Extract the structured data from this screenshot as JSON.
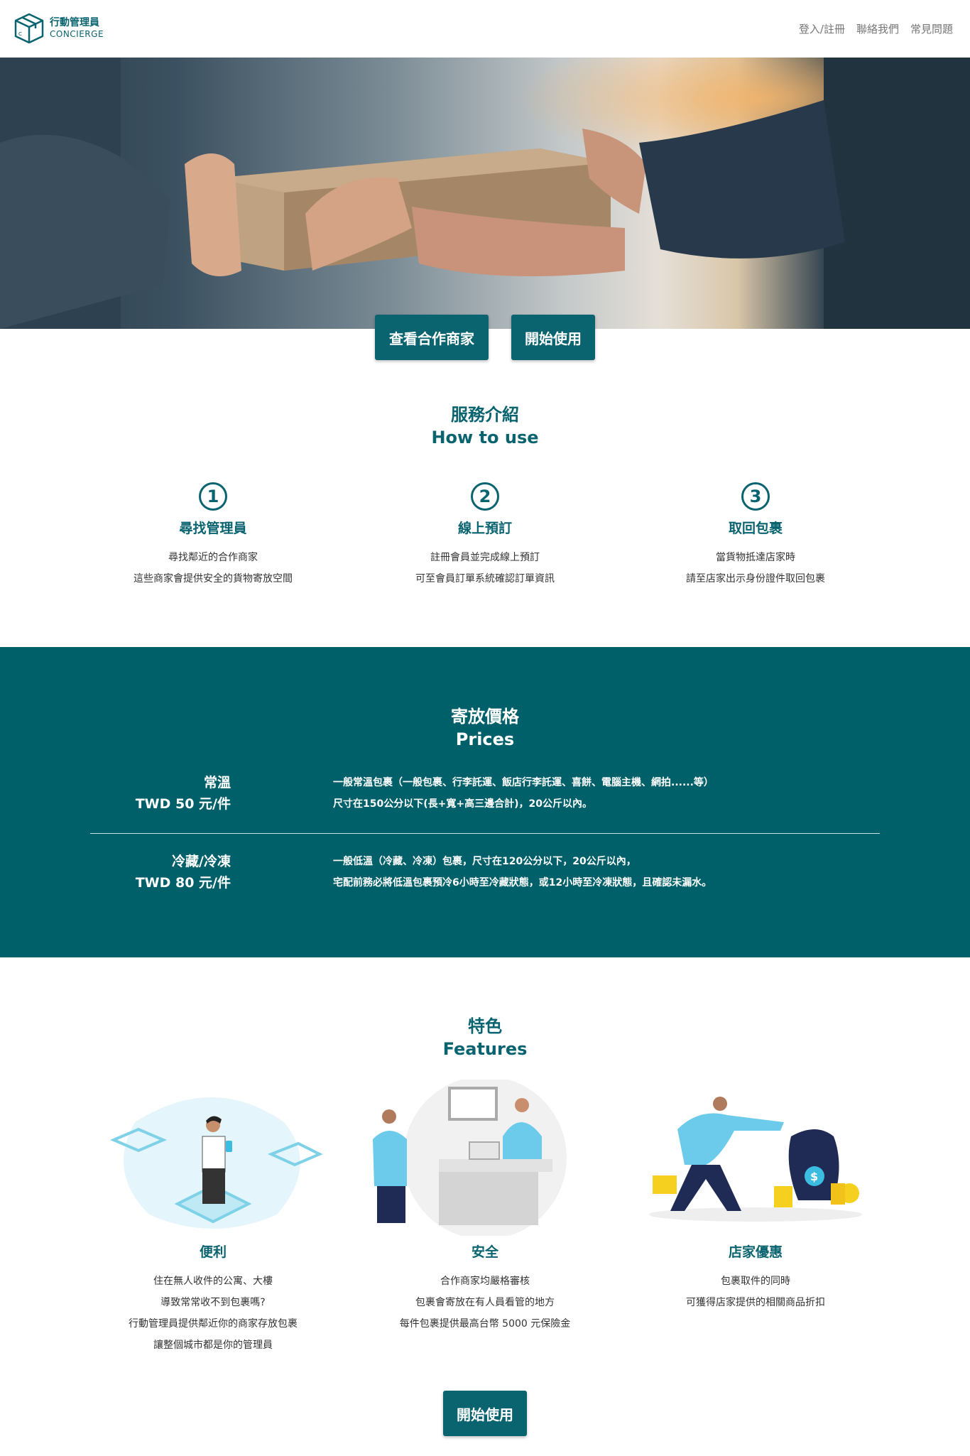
{
  "header": {
    "logo_zh": "行動管理員",
    "logo_en": "CONCIERGE",
    "nav": [
      "登入/註冊",
      "聯絡我們",
      "常見問題"
    ]
  },
  "hero": {
    "buttons": [
      "查看合作商家",
      "開始使用"
    ]
  },
  "how": {
    "title_zh": "服務介紹",
    "title_en": "How to use",
    "steps": [
      {
        "num": "1",
        "title": "尋找管理員",
        "lines": [
          "尋找鄰近的合作商家",
          "這些商家會提供安全的貨物寄放空間"
        ]
      },
      {
        "num": "2",
        "title": "線上預訂",
        "lines": [
          "註冊會員並完成線上預訂",
          "可至會員訂單系統確認訂單資訊"
        ]
      },
      {
        "num": "3",
        "title": "取回包裹",
        "lines": [
          "當貨物抵達店家時",
          "請至店家出示身份證件取回包裹"
        ]
      }
    ]
  },
  "prices": {
    "title_zh": "寄放價格",
    "title_en": "Prices",
    "rows": [
      {
        "name": "常溫",
        "price": "TWD 50 元/件",
        "lines": [
          "一般常溫包裹（一般包裹、行李託運、飯店行李託運、喜餅、電腦主機、網拍......等）",
          "尺寸在150公分以下(長+寬+高三邊合計)，20公斤以內。"
        ]
      },
      {
        "name": "冷藏/冷凍",
        "price": "TWD 80 元/件",
        "lines": [
          "一般低溫（冷藏、冷凍）包裹，尺寸在120公分以下，20公斤以內，",
          "宅配前務必將低溫包裹預冷6小時至冷藏狀態，或12小時至冷凍狀態，且確認未漏水。"
        ]
      }
    ]
  },
  "features": {
    "title_zh": "特色",
    "title_en": "Features",
    "items": [
      {
        "title": "便利",
        "lines": [
          "住在無人收件的公寓、大樓",
          "導致常常收不到包裹嗎?",
          "行動管理員提供鄰近你的商家存放包裹",
          "讓整個城市都是你的管理員"
        ]
      },
      {
        "title": "安全",
        "lines": [
          "合作商家均嚴格審核",
          "包裹會寄放在有人員看管的地方",
          "每件包裹提供最高台幣 5000 元保險金"
        ]
      },
      {
        "title": "店家優惠",
        "lines": [
          "包裹取件的同時",
          "可獲得店家提供的相關商品折扣"
        ]
      }
    ],
    "cta": "開始使用"
  },
  "colors": {
    "primary": "#0a6470",
    "band": "#00606a"
  }
}
